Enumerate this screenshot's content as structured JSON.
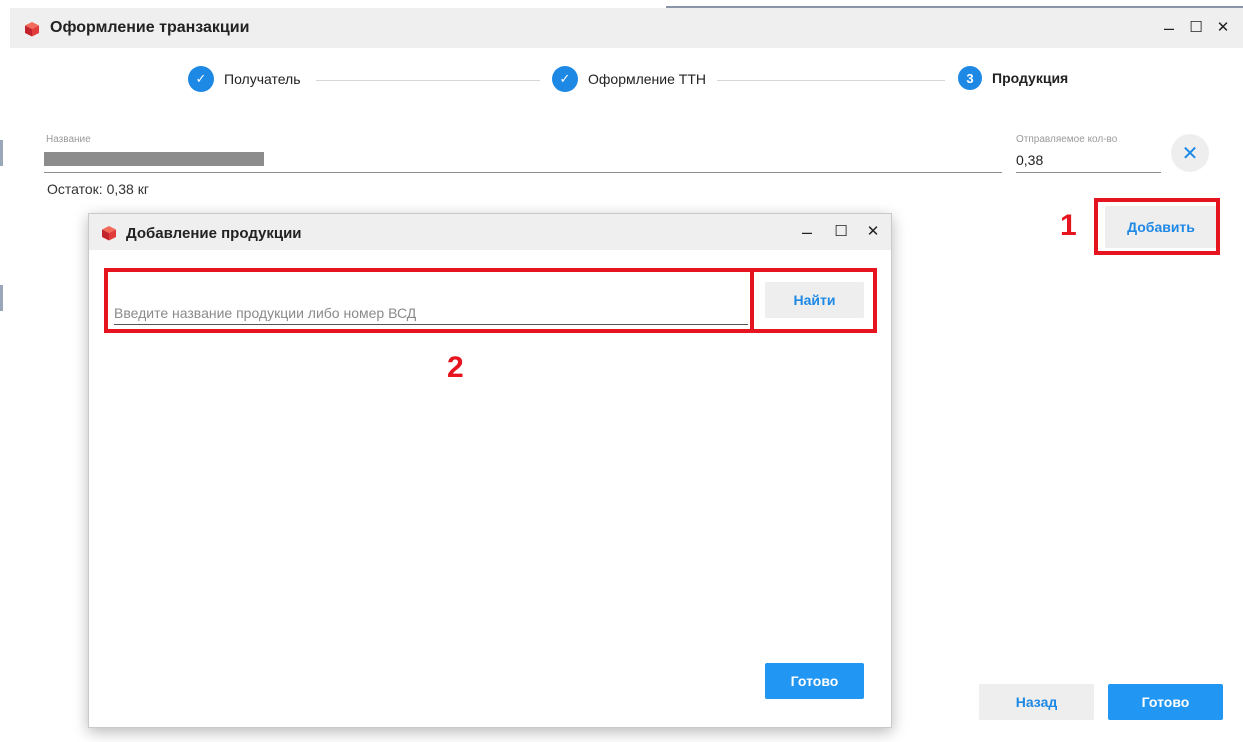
{
  "window": {
    "title": "Оформление транзакции",
    "controls": {
      "minimize": "–",
      "maximize": "☐",
      "close": "✕"
    }
  },
  "stepper": {
    "steps": [
      {
        "label": "Получатель",
        "state": "done",
        "marker": "✓"
      },
      {
        "label": "Оформление ТТН",
        "state": "done",
        "marker": "✓"
      },
      {
        "label": "Продукция",
        "state": "active",
        "marker": "3"
      }
    ]
  },
  "form": {
    "name_label": "Название",
    "qty_label": "Отправляемое кол-во",
    "qty_value": "0,38",
    "remainder": "Остаток: 0,38 кг",
    "clear_icon": "✕"
  },
  "buttons": {
    "add": "Добавить",
    "back": "Назад",
    "done": "Готово"
  },
  "dialog": {
    "title": "Добавление продукции",
    "controls": {
      "minimize": "–",
      "maximize": "☐",
      "close": "✕"
    },
    "search_placeholder": "Введите название продукции либо номер ВСД",
    "find_button": "Найти",
    "done_button": "Готово"
  },
  "annotations": {
    "marker_1": "1",
    "marker_2": "2"
  },
  "colors": {
    "accent": "#2196f3",
    "highlight": "#e5141e"
  },
  "icons": {
    "app": "red-box-icon",
    "step_done": "check-circle-icon",
    "clear": "close-icon"
  }
}
